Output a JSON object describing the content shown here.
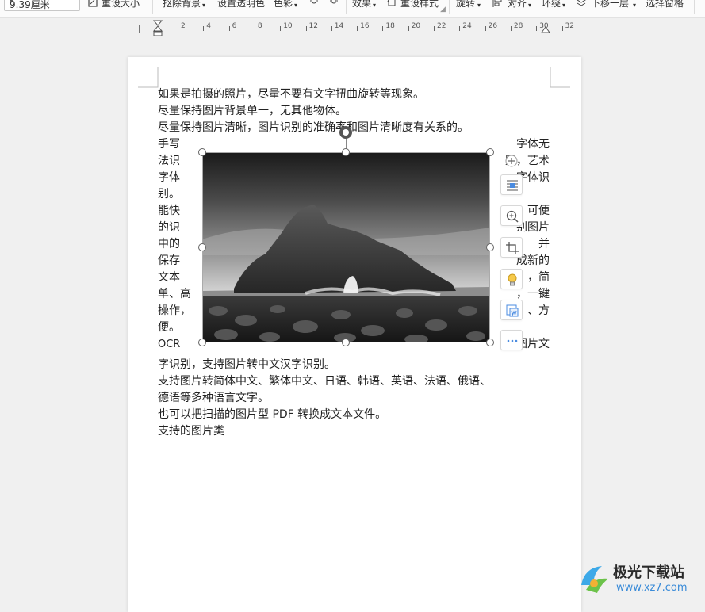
{
  "toolbar": {
    "size_value": "9.39厘米",
    "reset_size": "重设大小",
    "remove_bg": "抠除背景",
    "set_transparent": "设置透明色",
    "color": "色彩",
    "effects": "效果",
    "reset_style": "重设样式",
    "rotate": "旋转",
    "align": "对齐",
    "wrap": "环绕",
    "move_down": "下移一层",
    "selection_pane": "选择窗格"
  },
  "ruler": {
    "labels": [
      "2",
      "4",
      "6",
      "8",
      "10",
      "12",
      "14",
      "16",
      "18",
      "20",
      "22",
      "24",
      "26",
      "28",
      "30",
      "32"
    ]
  },
  "document": {
    "line1": "如果是拍摄的照片，尽量不要有文字扭曲旋转等现象。",
    "line2": "尽量保持图片背景单一，无其他物体。",
    "line3": "尽量保持图片清晰，图片识别的准确率和图片清晰度有关系的。",
    "left_col": [
      "手写",
      "法识",
      "字体",
      "别。",
      "能快",
      "的识",
      "中的",
      "保存",
      "文本",
      "单、高",
      "操作，",
      "便。",
      "OCR"
    ],
    "right_col": [
      "字体无",
      "别，艺术",
      "字体识",
      "",
      "可便",
      "别图片",
      "并",
      "成新的",
      "，简",
      "，一键",
      "、方",
      "",
      "图片文"
    ],
    "line4": "字识别，支持图片转中文汉字识别。",
    "line5": "支持图片转简体中文、繁体中文、日语、韩语、英语、法语、俄语、",
    "line6": "德语等多种语言文字。",
    "line7": "也可以把扫描的图片型 PDF 转换成文本文件。",
    "line8": "支持的图片类"
  },
  "image": {
    "description_icon": "rock-arch-photo"
  },
  "side_tools": [
    "add-icon",
    "wrap-text-icon",
    "zoom-in-icon",
    "crop-icon",
    "idea-icon",
    "image-translate-icon",
    "more-icon"
  ],
  "watermark": {
    "cn": "极光下载站",
    "url": "www.xz7.com"
  }
}
